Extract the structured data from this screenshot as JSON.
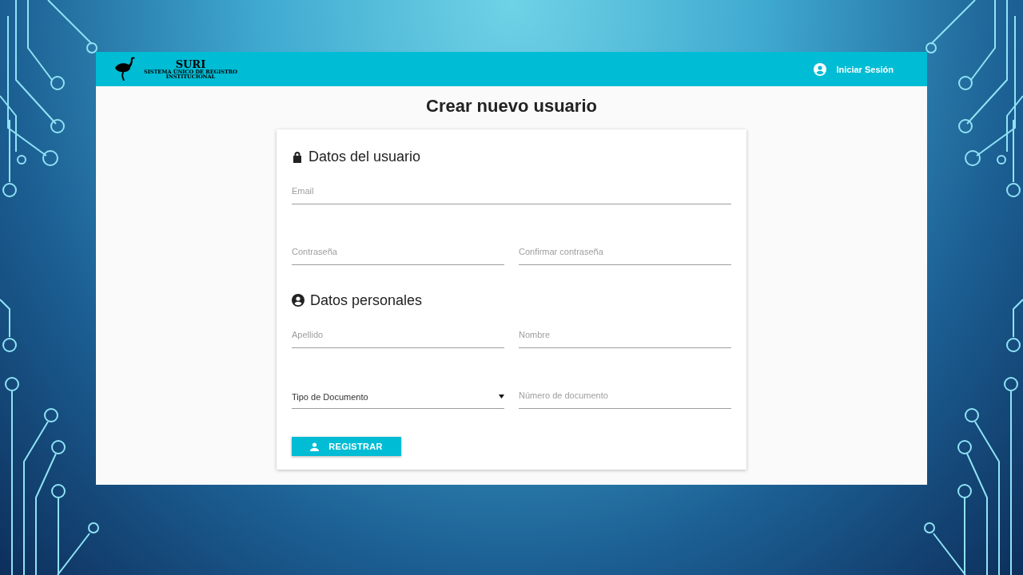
{
  "header": {
    "logo": {
      "title": "SURI",
      "subtitle_1": "SISTEMA ÚNICO DE REGISTRO",
      "subtitle_2": "INSTITUCIONAL"
    },
    "login": "Iniciar Sesión"
  },
  "page_title": "Crear nuevo usuario",
  "sections": [
    {
      "kind": "credentials",
      "title": "Datos del usuario",
      "rows": [
        [
          {
            "kind": "text",
            "placeholder": "Email"
          }
        ],
        [
          {
            "kind": "text",
            "placeholder": "Contraseña"
          },
          {
            "kind": "text",
            "placeholder": "Confirmar contraseña"
          }
        ]
      ]
    },
    {
      "kind": "personal",
      "title": "Datos personales",
      "rows": [
        [
          {
            "kind": "text",
            "placeholder": "Apellido"
          },
          {
            "kind": "text",
            "placeholder": "Nombre"
          }
        ],
        [
          {
            "kind": "select",
            "placeholder": "Tipo de Documento"
          },
          {
            "kind": "text",
            "placeholder": "Número de documento"
          }
        ]
      ]
    }
  ],
  "submit": "REGISTRAR"
}
